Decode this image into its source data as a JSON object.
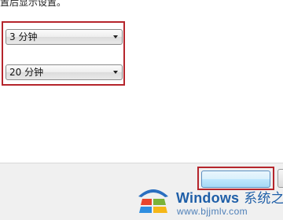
{
  "dialog": {
    "top_text": "置后显示设置。",
    "dropdowns": [
      {
        "selected": "3 分钟"
      },
      {
        "selected": "20 分钟"
      }
    ]
  },
  "watermark": {
    "brand": "Windows",
    "brand_cn": "系统之家",
    "url": "www.bjjmlv.com"
  },
  "colors": {
    "highlight_frame": "#b5252c",
    "watermark_blue": "#1f5fa8"
  }
}
